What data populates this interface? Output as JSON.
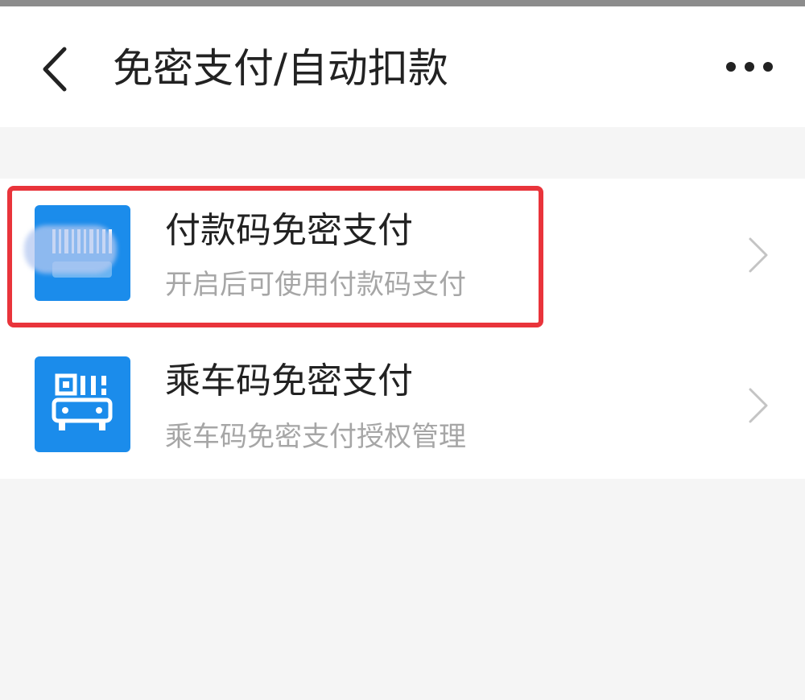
{
  "header": {
    "title": "免密支付/自动扣款",
    "back_icon": "chevron-left-icon",
    "more_icon": "more-horizontal-icon"
  },
  "items": [
    {
      "title": "付款码免密支付",
      "subtitle": "开启后可使用付款码支付",
      "icon": "barcode-icon",
      "icon_color": "#1b8ceb",
      "highlighted": true
    },
    {
      "title": "乘车码免密支付",
      "subtitle": "乘车码免密支付授权管理",
      "icon": "bus-qr-icon",
      "icon_color": "#1b8ceb",
      "highlighted": false
    }
  ],
  "colors": {
    "highlight_border": "#e9343b",
    "accent": "#1b8ceb",
    "page_background": "#f5f5f5"
  }
}
